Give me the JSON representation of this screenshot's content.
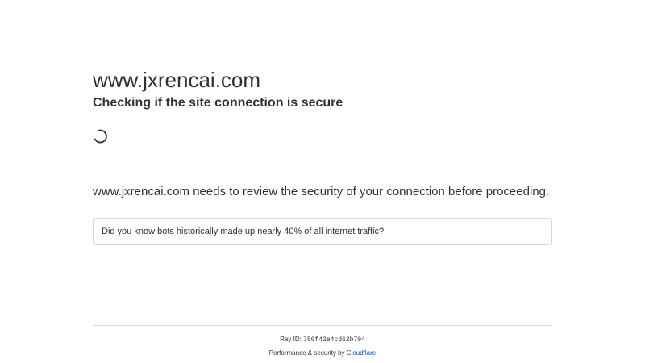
{
  "site": {
    "domain": "www.jxrencai.com",
    "status": "Checking if the site connection is secure"
  },
  "review_message": "www.jxrencai.com needs to review the security of your connection before proceeding.",
  "fact": "Did you know bots historically made up nearly 40% of all internet traffic?",
  "footer": {
    "ray_label": "Ray ID:",
    "ray_id": "750f42e4cd62b704",
    "perf_label": "Performance & security by",
    "provider_link": "Cloudflare"
  },
  "icons": {
    "spinner": "loading-spinner-icon"
  },
  "colors": {
    "text": "#313131",
    "link": "#0051c3",
    "border": "#d9d9d9",
    "background": "#ffffff"
  }
}
